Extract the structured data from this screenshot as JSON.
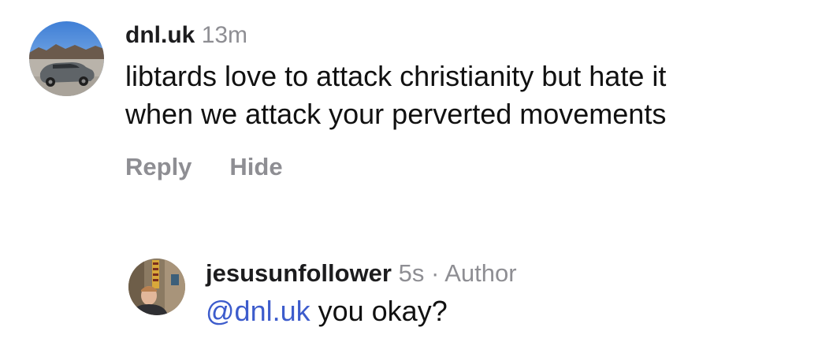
{
  "comments": [
    {
      "username": "dnl.uk",
      "time": "13m",
      "text": "libtards love to attack christianity but hate it\nwhen we attack your perverted movements",
      "actions": {
        "reply": "Reply",
        "hide": "Hide"
      }
    },
    {
      "username": "jesusunfollower",
      "time": "5s",
      "separator": "·",
      "badge": "Author",
      "mention": "@dnl.uk",
      "text": " you okay?"
    }
  ],
  "icons": {
    "avatar1": "car-photo-avatar",
    "avatar2": "person-photo-avatar"
  },
  "colors": {
    "mention": "#3d5ccc",
    "muted": "#8e8e93"
  }
}
